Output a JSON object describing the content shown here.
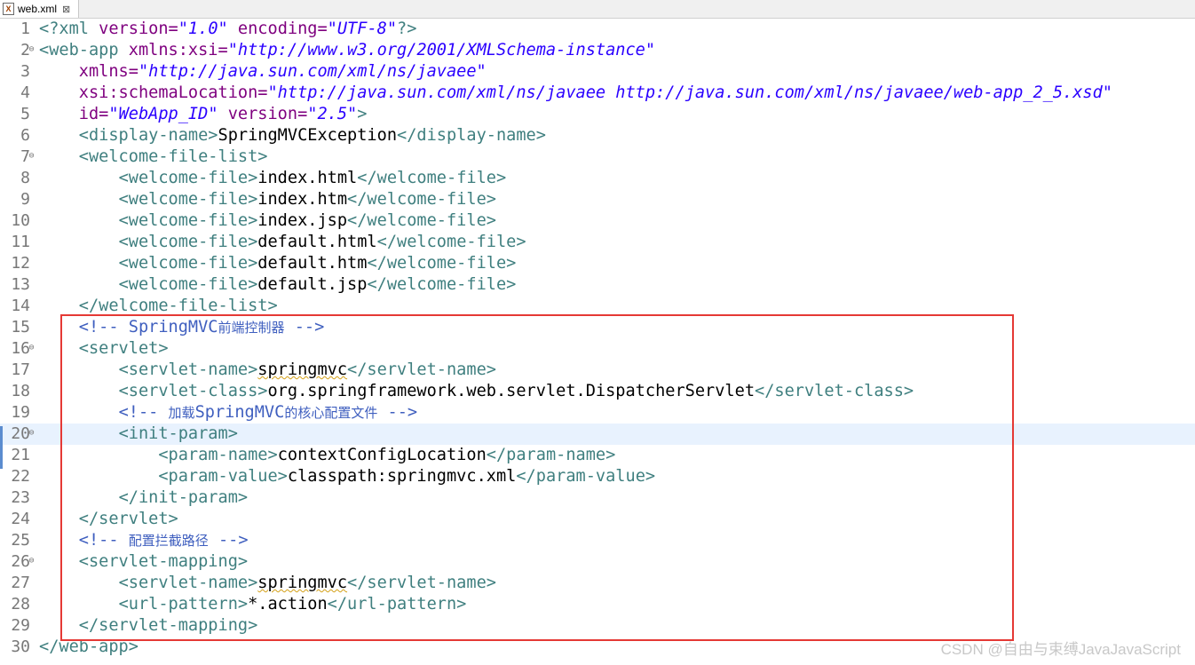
{
  "tab": {
    "title": "web.xml",
    "icon": "xml-file-icon",
    "close_glyph": "⊠"
  },
  "editor": {
    "current_line": 20,
    "lines": [
      {
        "n": "1",
        "fold": false,
        "tokens": [
          {
            "t": "<?xml ",
            "c": "tag"
          },
          {
            "t": "version=",
            "c": "attr"
          },
          {
            "t": "\"1.0\"",
            "c": "val"
          },
          {
            "t": " encoding=",
            "c": "attr"
          },
          {
            "t": "\"UTF-8\"",
            "c": "val"
          },
          {
            "t": "?>",
            "c": "tag"
          }
        ]
      },
      {
        "n": "2",
        "fold": true,
        "tokens": [
          {
            "t": "<web-app ",
            "c": "tag"
          },
          {
            "t": "xmlns:xsi=",
            "c": "attr"
          },
          {
            "t": "\"http://www.w3.org/2001/XMLSchema-instance\"",
            "c": "val"
          }
        ]
      },
      {
        "n": "3",
        "fold": false,
        "tokens": [
          {
            "t": "    ",
            "c": "txt"
          },
          {
            "t": "xmlns=",
            "c": "attr"
          },
          {
            "t": "\"http://java.sun.com/xml/ns/javaee\"",
            "c": "val"
          }
        ]
      },
      {
        "n": "4",
        "fold": false,
        "tokens": [
          {
            "t": "    ",
            "c": "txt"
          },
          {
            "t": "xsi:schemaLocation=",
            "c": "attr"
          },
          {
            "t": "\"http://java.sun.com/xml/ns/javaee http://java.sun.com/xml/ns/javaee/web-app_2_5.xsd\"",
            "c": "val"
          }
        ]
      },
      {
        "n": "5",
        "fold": false,
        "tokens": [
          {
            "t": "    ",
            "c": "txt"
          },
          {
            "t": "id=",
            "c": "attr"
          },
          {
            "t": "\"WebApp_ID\"",
            "c": "val"
          },
          {
            "t": " version=",
            "c": "attr"
          },
          {
            "t": "\"2.5\"",
            "c": "val"
          },
          {
            "t": ">",
            "c": "tag"
          }
        ]
      },
      {
        "n": "6",
        "fold": false,
        "tokens": [
          {
            "t": "    ",
            "c": "txt"
          },
          {
            "t": "<display-name>",
            "c": "tag"
          },
          {
            "t": "SpringMVCException",
            "c": "txt"
          },
          {
            "t": "</display-name>",
            "c": "tag"
          }
        ]
      },
      {
        "n": "7",
        "fold": true,
        "tokens": [
          {
            "t": "    ",
            "c": "txt"
          },
          {
            "t": "<welcome-file-list>",
            "c": "tag"
          }
        ]
      },
      {
        "n": "8",
        "fold": false,
        "tokens": [
          {
            "t": "        ",
            "c": "txt"
          },
          {
            "t": "<welcome-file>",
            "c": "tag"
          },
          {
            "t": "index.html",
            "c": "txt"
          },
          {
            "t": "</welcome-file>",
            "c": "tag"
          }
        ]
      },
      {
        "n": "9",
        "fold": false,
        "tokens": [
          {
            "t": "        ",
            "c": "txt"
          },
          {
            "t": "<welcome-file>",
            "c": "tag"
          },
          {
            "t": "index.htm",
            "c": "txt"
          },
          {
            "t": "</welcome-file>",
            "c": "tag"
          }
        ]
      },
      {
        "n": "10",
        "fold": false,
        "tokens": [
          {
            "t": "        ",
            "c": "txt"
          },
          {
            "t": "<welcome-file>",
            "c": "tag"
          },
          {
            "t": "index.jsp",
            "c": "txt"
          },
          {
            "t": "</welcome-file>",
            "c": "tag"
          }
        ]
      },
      {
        "n": "11",
        "fold": false,
        "tokens": [
          {
            "t": "        ",
            "c": "txt"
          },
          {
            "t": "<welcome-file>",
            "c": "tag"
          },
          {
            "t": "default.html",
            "c": "txt"
          },
          {
            "t": "</welcome-file>",
            "c": "tag"
          }
        ]
      },
      {
        "n": "12",
        "fold": false,
        "tokens": [
          {
            "t": "        ",
            "c": "txt"
          },
          {
            "t": "<welcome-file>",
            "c": "tag"
          },
          {
            "t": "default.htm",
            "c": "txt"
          },
          {
            "t": "</welcome-file>",
            "c": "tag"
          }
        ]
      },
      {
        "n": "13",
        "fold": false,
        "tokens": [
          {
            "t": "        ",
            "c": "txt"
          },
          {
            "t": "<welcome-file>",
            "c": "tag"
          },
          {
            "t": "default.jsp",
            "c": "txt"
          },
          {
            "t": "</welcome-file>",
            "c": "tag"
          }
        ]
      },
      {
        "n": "14",
        "fold": false,
        "tokens": [
          {
            "t": "    ",
            "c": "txt"
          },
          {
            "t": "</welcome-file-list>",
            "c": "tag"
          }
        ]
      },
      {
        "n": "15",
        "fold": false,
        "tokens": [
          {
            "t": "    ",
            "c": "txt"
          },
          {
            "t": "<!-- SpringMVC",
            "c": "cmt"
          },
          {
            "t": "前端控制器",
            "c": "cmt cmt-cjk"
          },
          {
            "t": " -->",
            "c": "cmt"
          }
        ]
      },
      {
        "n": "16",
        "fold": true,
        "tokens": [
          {
            "t": "    ",
            "c": "txt"
          },
          {
            "t": "<servlet>",
            "c": "tag"
          }
        ]
      },
      {
        "n": "17",
        "fold": false,
        "tokens": [
          {
            "t": "        ",
            "c": "txt"
          },
          {
            "t": "<servlet-name>",
            "c": "tag"
          },
          {
            "t": "springmvc",
            "c": "txt squiggle"
          },
          {
            "t": "</servlet-name>",
            "c": "tag"
          }
        ]
      },
      {
        "n": "18",
        "fold": false,
        "tokens": [
          {
            "t": "        ",
            "c": "txt"
          },
          {
            "t": "<servlet-class>",
            "c": "tag"
          },
          {
            "t": "org.springframework.web.servlet.DispatcherServlet",
            "c": "txt"
          },
          {
            "t": "</servlet-class>",
            "c": "tag"
          }
        ]
      },
      {
        "n": "19",
        "fold": false,
        "tokens": [
          {
            "t": "        ",
            "c": "txt"
          },
          {
            "t": "<!-- ",
            "c": "cmt"
          },
          {
            "t": "加载",
            "c": "cmt cmt-cjk"
          },
          {
            "t": "SpringMVC",
            "c": "cmt"
          },
          {
            "t": "的核心配置文件",
            "c": "cmt cmt-cjk"
          },
          {
            "t": " -->",
            "c": "cmt"
          }
        ]
      },
      {
        "n": "20",
        "fold": true,
        "tokens": [
          {
            "t": "        ",
            "c": "txt"
          },
          {
            "t": "<init-param>",
            "c": "tag"
          }
        ]
      },
      {
        "n": "21",
        "fold": false,
        "tokens": [
          {
            "t": "            ",
            "c": "txt"
          },
          {
            "t": "<param-name>",
            "c": "tag"
          },
          {
            "t": "contextConfigLocation",
            "c": "txt"
          },
          {
            "t": "</param-name>",
            "c": "tag"
          }
        ]
      },
      {
        "n": "22",
        "fold": false,
        "tokens": [
          {
            "t": "            ",
            "c": "txt"
          },
          {
            "t": "<param-value>",
            "c": "tag"
          },
          {
            "t": "classpath:springmvc.xml",
            "c": "txt"
          },
          {
            "t": "</param-value>",
            "c": "tag"
          }
        ]
      },
      {
        "n": "23",
        "fold": false,
        "tokens": [
          {
            "t": "        ",
            "c": "txt"
          },
          {
            "t": "</init-param>",
            "c": "tag"
          }
        ]
      },
      {
        "n": "24",
        "fold": false,
        "tokens": [
          {
            "t": "    ",
            "c": "txt"
          },
          {
            "t": "</servlet>",
            "c": "tag"
          }
        ]
      },
      {
        "n": "25",
        "fold": false,
        "tokens": [
          {
            "t": "    ",
            "c": "txt"
          },
          {
            "t": "<!-- ",
            "c": "cmt"
          },
          {
            "t": "配置拦截路径",
            "c": "cmt cmt-cjk"
          },
          {
            "t": " -->",
            "c": "cmt"
          }
        ]
      },
      {
        "n": "26",
        "fold": true,
        "tokens": [
          {
            "t": "    ",
            "c": "txt"
          },
          {
            "t": "<servlet-mapping>",
            "c": "tag"
          }
        ]
      },
      {
        "n": "27",
        "fold": false,
        "tokens": [
          {
            "t": "        ",
            "c": "txt"
          },
          {
            "t": "<servlet-name>",
            "c": "tag"
          },
          {
            "t": "springmvc",
            "c": "txt squiggle"
          },
          {
            "t": "</servlet-name>",
            "c": "tag"
          }
        ]
      },
      {
        "n": "28",
        "fold": false,
        "tokens": [
          {
            "t": "        ",
            "c": "txt"
          },
          {
            "t": "<url-pattern>",
            "c": "tag"
          },
          {
            "t": "*.action",
            "c": "txt"
          },
          {
            "t": "</url-pattern>",
            "c": "tag"
          }
        ]
      },
      {
        "n": "29",
        "fold": false,
        "tokens": [
          {
            "t": "    ",
            "c": "txt"
          },
          {
            "t": "</servlet-mapping>",
            "c": "tag"
          }
        ]
      },
      {
        "n": "30",
        "fold": false,
        "tokens": [
          {
            "t": "</web-app>",
            "c": "tag"
          }
        ]
      }
    ]
  },
  "watermark": "CSDN @自由与束缚JavaJavaScript",
  "colors": {
    "tag": "#3f7f7f",
    "attribute": "#7f007f",
    "value": "#2a00ff",
    "comment": "#3f5fbf",
    "highlight_box": "#e53935",
    "current_line": "#e8f2fe"
  }
}
